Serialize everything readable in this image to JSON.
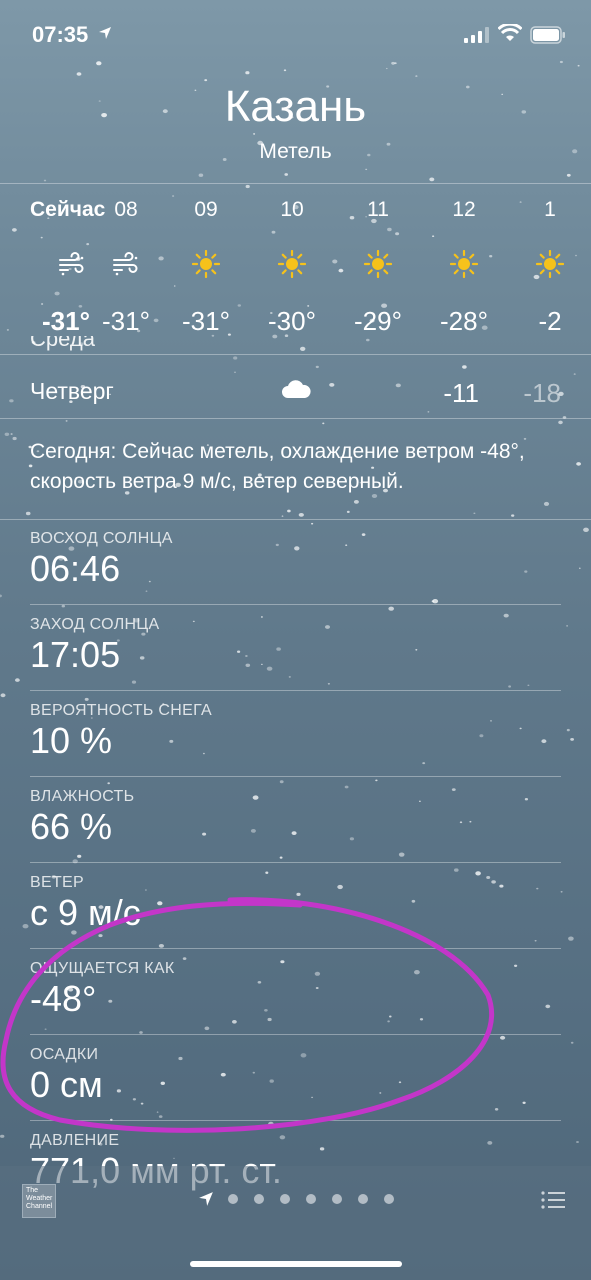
{
  "status_bar": {
    "time": "07:35"
  },
  "location": {
    "city": "Казань",
    "condition": "Метель"
  },
  "hourly": [
    {
      "label": "Сейчас",
      "icon": "wind-snow-icon",
      "temp": "-31°"
    },
    {
      "label": "08",
      "icon": "wind-snow-icon",
      "temp": "-31°"
    },
    {
      "label": "09",
      "icon": "sun-icon",
      "temp": "-31°"
    },
    {
      "label": "10",
      "icon": "sun-icon",
      "temp": "-30°"
    },
    {
      "label": "11",
      "icon": "sun-icon",
      "temp": "-29°"
    },
    {
      "label": "12",
      "icon": "sun-icon",
      "temp": "-28°"
    },
    {
      "label": "1",
      "icon": "sun-icon",
      "temp": "-2"
    }
  ],
  "daily": {
    "partial_above": "Среда",
    "row": {
      "day": "Четверг",
      "icon": "cloud-icon",
      "high": "-11",
      "low": "-18"
    }
  },
  "summary": "Сегодня: Сейчас метель, охлаждение ветром -48°, скорость ветра 9 м/с, ветер северный.",
  "details": [
    {
      "label": "ВОСХОД СОЛНЦА",
      "value": "06:46"
    },
    {
      "label": "ЗАХОД СОЛНЦА",
      "value": "17:05"
    },
    {
      "label": "ВЕРОЯТНОСТЬ СНЕГА",
      "value": "10 %"
    },
    {
      "label": "ВЛАЖНОСТЬ",
      "value": "66 %"
    },
    {
      "label": "ВЕТЕР",
      "value": "с 9 м/с"
    },
    {
      "label": "ОЩУЩАЕТСЯ КАК",
      "value": "-48°"
    },
    {
      "label": "ОСАДКИ",
      "value": "0 см"
    },
    {
      "label": "ДАВЛЕНИЕ",
      "value": "771,0 мм рт. ст."
    }
  ],
  "footer": {
    "provider_logo": "The Weather Channel",
    "page_count": 7
  },
  "colors": {
    "sun": "#f6c21b",
    "annotation": "#c336c9"
  }
}
